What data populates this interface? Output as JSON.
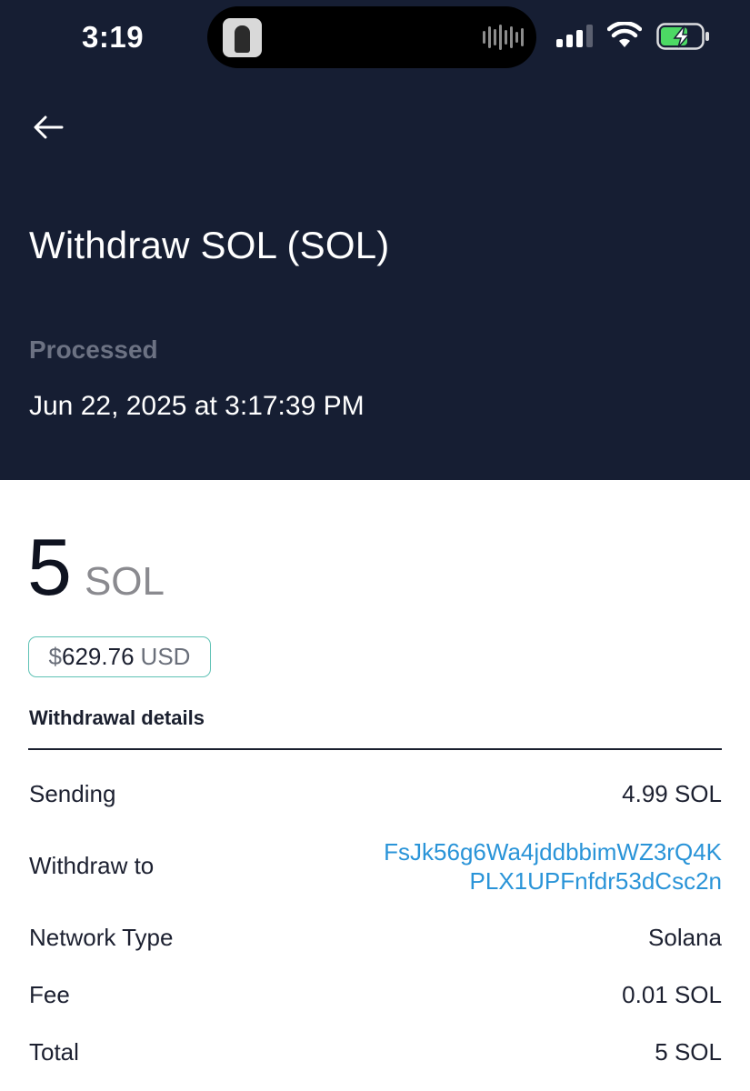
{
  "status_bar": {
    "time": "3:19",
    "signal_bars": 4,
    "signal_bars_active": 3,
    "battery_state": "charging",
    "battery_color": "#4cd964"
  },
  "header": {
    "background_color": "#161e33",
    "back_icon": "arrow-left-icon",
    "title": "Withdraw SOL (SOL)",
    "status": "Processed",
    "datetime": "Jun 22, 2025 at 3:17:39 PM"
  },
  "summary": {
    "amount": "5",
    "unit": "SOL",
    "usd_symbol": "$",
    "usd_value": "629.76",
    "usd_currency": "USD",
    "chip_border_color": "#5fc2b5"
  },
  "details": {
    "title": "Withdrawal details",
    "rows": [
      {
        "label": "Sending",
        "value": "4.99 SOL"
      },
      {
        "label": "Withdraw to",
        "value_line1": "FsJk56g6Wa4jddbbimWZ3rQ4K",
        "value_line2": "PLX1UPFnfdr53dCsc2n",
        "link_color": "#2a94d8"
      },
      {
        "label": "Network Type",
        "value": "Solana"
      },
      {
        "label": "Fee",
        "value": "0.01 SOL"
      },
      {
        "label": "Total",
        "value": "5 SOL"
      }
    ]
  }
}
